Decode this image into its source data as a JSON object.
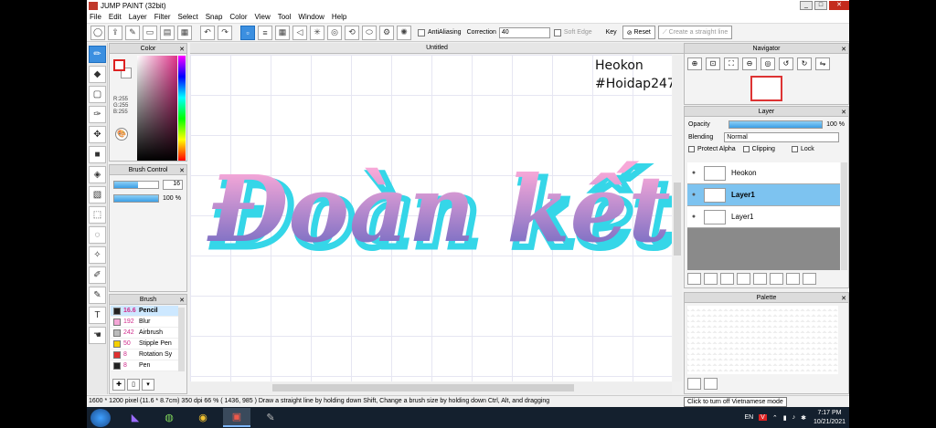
{
  "window": {
    "title": "JUMP PAINT (32bit)"
  },
  "menu": [
    "File",
    "Edit",
    "Layer",
    "Filter",
    "Select",
    "Snap",
    "Color",
    "View",
    "Tool",
    "Window",
    "Help"
  ],
  "toolbar": {
    "antialiasing_label": "AntiAliasing",
    "correction_label": "Correction",
    "correction_value": "40",
    "soft_edge_label": "Soft Edge",
    "key_label": "Key",
    "reset_label": "Reset",
    "straight_line_label": "Create a straight line"
  },
  "color_panel": {
    "title": "Color",
    "rgb": [
      "R:255",
      "G:255",
      "B:255"
    ]
  },
  "brush_control": {
    "title": "Brush Control",
    "size_value": "16",
    "opacity_value": "100",
    "opacity_unit": "%",
    "size_fraction": 0.55,
    "opacity_fraction": 1.0
  },
  "brush_panel": {
    "title": "Brush",
    "items": [
      {
        "size": "16.6",
        "name": "Pencil",
        "color": "#222222"
      },
      {
        "size": "192",
        "name": "Blur",
        "color": "#f4a6d6"
      },
      {
        "size": "242",
        "name": "Airbrush",
        "color": "#bbbbbb"
      },
      {
        "size": "50",
        "name": "Stipple Pen",
        "color": "#f5d000"
      },
      {
        "size": "8",
        "name": "Rotation Sy",
        "color": "#e03030"
      },
      {
        "size": "8",
        "name": "Pen",
        "color": "#222222"
      }
    ]
  },
  "canvas": {
    "tab_title": "Untitled",
    "watermark_line1": "Heokon",
    "watermark_line2": "#Hoidap247",
    "art_text": "Đoàn kết",
    "colors": {
      "top": "#f7a8d8",
      "bottom": "#7b6fc4",
      "shadow": "#35d6e8"
    }
  },
  "navigator": {
    "title": "Navigator"
  },
  "layer_panel": {
    "title": "Layer",
    "opacity_label": "Opacity",
    "opacity_value": "100",
    "opacity_unit": "%",
    "blending_label": "Blending",
    "blending_value": "Normal",
    "protect_alpha_label": "Protect Alpha",
    "clipping_label": "Clipping",
    "lock_label": "Lock",
    "layers": [
      {
        "name": "Heokon",
        "selected": false
      },
      {
        "name": "Layer1",
        "selected": true
      },
      {
        "name": "Layer1",
        "selected": false
      }
    ]
  },
  "palette": {
    "title": "Palette",
    "tooltip": "Click to turn off Vietnamese mode"
  },
  "status": {
    "text": "1600 * 1200 pixel  (11.6 * 8.7cm)  350 dpi  66 %  ( 1436, 985 )  Draw a straight line by holding down Shift, Change a brush size by holding down Ctrl, Alt, and dragging"
  },
  "taskbar": {
    "lang": "EN",
    "ime": "V",
    "time": "7:17 PM",
    "date": "10/21/2021"
  }
}
